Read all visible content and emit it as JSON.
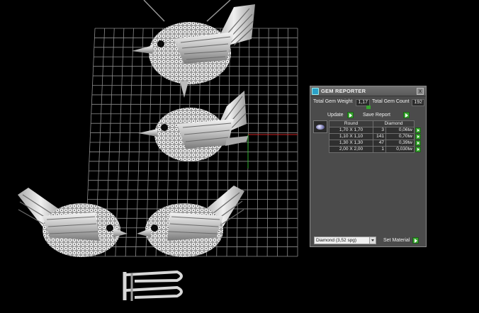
{
  "gem_reporter": {
    "title": "GEM REPORTER",
    "close_label": "x",
    "total_weight_label": "Total Gem Weight",
    "total_weight_value": "1,17",
    "total_count_label": "Total Gem Count",
    "total_count_value": "192",
    "update_label": "Update",
    "save_report_label": "Save Report",
    "table": {
      "headers": [
        "Round",
        "Diamond"
      ],
      "rows": [
        {
          "size": "1,70 X 1,70",
          "count": "3",
          "weight": "0,06tw"
        },
        {
          "size": "1,10 X 1,10",
          "count": "141",
          "weight": "0,70tw"
        },
        {
          "size": "1,30 X 1,30",
          "count": "47",
          "weight": "0,39tw"
        },
        {
          "size": "2,00 X 2,00",
          "count": "1",
          "weight": "0,030tw"
        }
      ]
    },
    "material_value": "Diamond    (3,52 spg)",
    "set_material_label": "Set Material"
  },
  "colors": {
    "background": "#000000",
    "grid": "#8c8c8c",
    "axis_red": "#d02020",
    "accent_green": "#37a52f",
    "panel": "#4b4b4b",
    "metal": "#d8d8d8"
  }
}
